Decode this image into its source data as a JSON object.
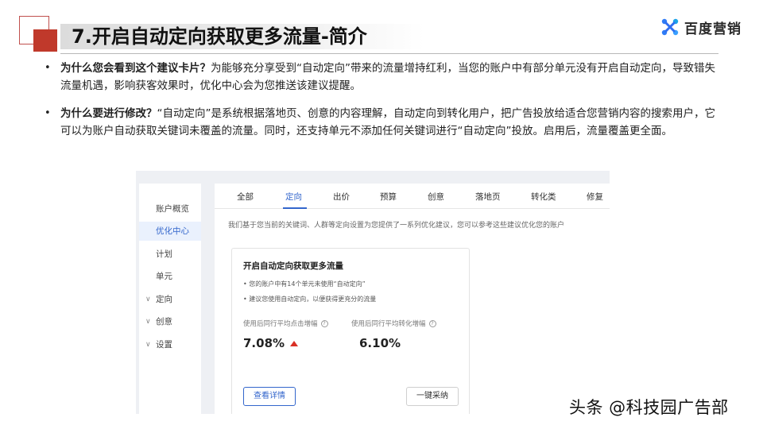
{
  "slide": {
    "title": "7.开启自动定向获取更多流量-简介",
    "brand": "百度营销"
  },
  "bullets": [
    {
      "heading": "为什么您会看到这个建议卡片？",
      "text": "为能够充分享受到“自动定向”带来的流量增持红利，当您的账户中有部分单元没有开启自动定向，导致错失流量机遇，影响获客效果时，优化中心会为您推送该建议提醒。"
    },
    {
      "heading": "为什么要进行修改？",
      "text": "“自动定向”是系统根据落地页、创意的内容理解，自动定向到转化用户，把广告投放给适合您营销内容的搜索用户，它可以为账户自动获取关键词未覆盖的流量。同时，还支持单元不添加任何关键词进行“自动定向”投放。启用后，流量覆盖更全面。"
    }
  ],
  "screenshot": {
    "sidebar": [
      {
        "label": "账户概览",
        "active": false,
        "chevron": false
      },
      {
        "label": "优化中心",
        "active": true,
        "chevron": false
      },
      {
        "label": "计划",
        "active": false,
        "chevron": false
      },
      {
        "label": "单元",
        "active": false,
        "chevron": false
      },
      {
        "label": "定向",
        "active": false,
        "chevron": true
      },
      {
        "label": "创意",
        "active": false,
        "chevron": true
      },
      {
        "label": "设置",
        "active": false,
        "chevron": true
      }
    ],
    "tabs": [
      "全部",
      "定向",
      "出价",
      "预算",
      "创意",
      "落地页",
      "转化类",
      "修复"
    ],
    "active_tab": "定向",
    "intro": "我们基于您当前的关键词、人群等定向设置为您提供了一系列优化建议，您可以参考这些建议优化您的账户",
    "card": {
      "title": "开启自动定向获取更多流量",
      "lines": [
        "• 您的账户中有14个单元未使用“自动定向”",
        "• 建议您使用自动定向，以便获得更充分的流量"
      ],
      "metric1_label": "使用后同行平均点击增幅",
      "metric1_value": "7.08%",
      "metric2_label": "使用后同行平均转化增幅",
      "metric2_value": "6.10%",
      "primary_button": "查看详情",
      "secondary_button": "一键采纳"
    }
  },
  "watermark": "头条 @科技园广告部",
  "colors": {
    "accent_red": "#c0392b",
    "link_blue": "#3366cc",
    "increase_red": "#d93025"
  }
}
